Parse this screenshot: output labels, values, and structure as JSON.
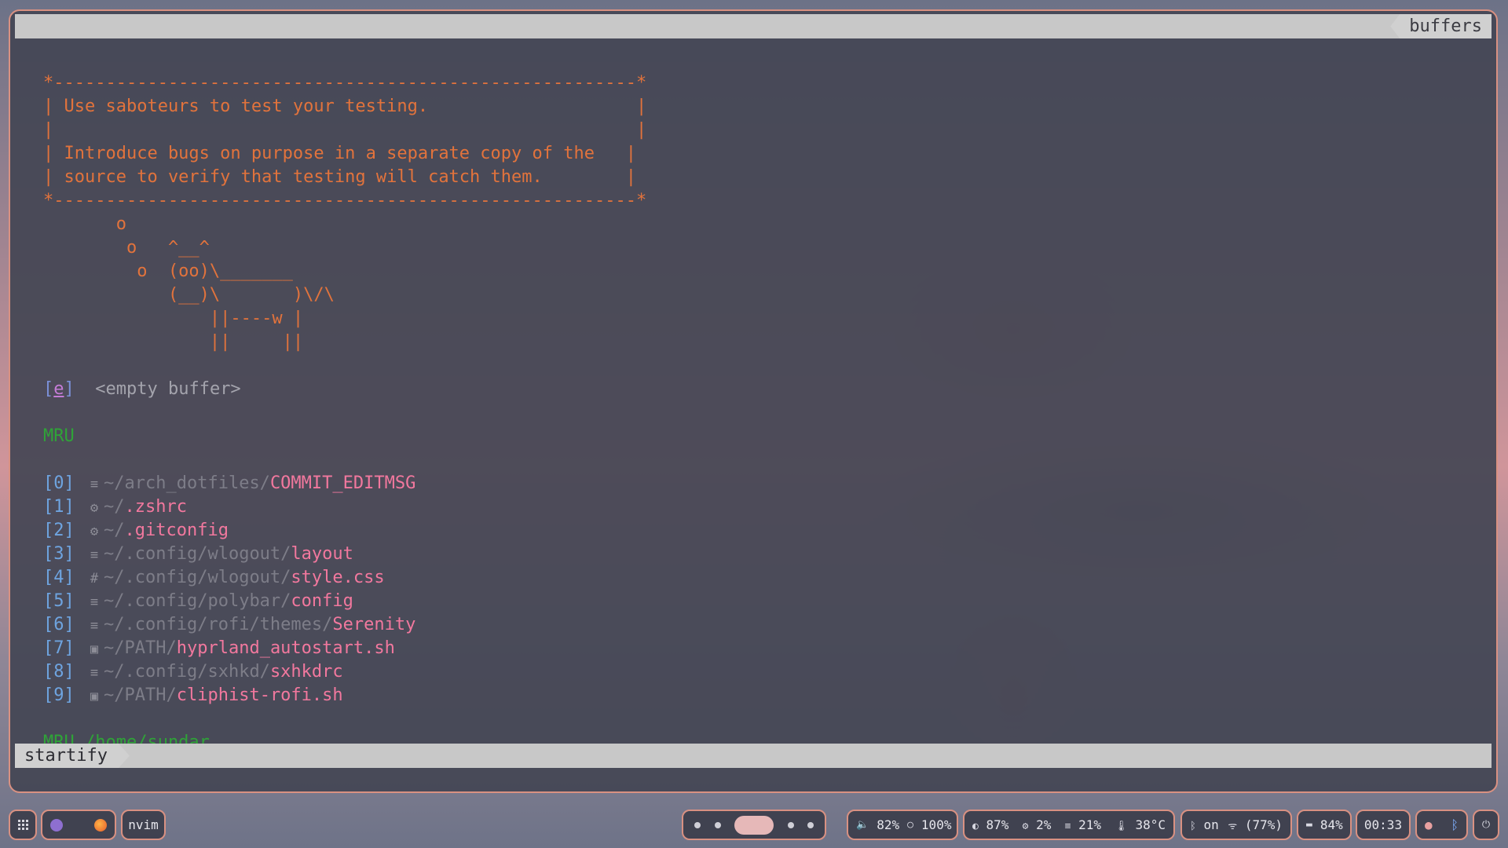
{
  "tabline": {
    "buffers_label": "buffers"
  },
  "banner": [
    "*--------------------------------------------------------*",
    "| Use saboteurs to test your testing.                    |",
    "|                                                        |",
    "| Introduce bugs on purpose in a separate copy of the   |",
    "| source to verify that testing will catch them.        |",
    "*--------------------------------------------------------*",
    "       o",
    "        o   ^__^",
    "         o  (oo)\\_______",
    "            (__)\\       )\\/\\",
    "                ||----w |",
    "                ||     ||"
  ],
  "empty_buffer": {
    "key": "e",
    "label": "<empty buffer>"
  },
  "mru": {
    "header": "MRU",
    "items": [
      {
        "index": "0",
        "icon": "≡",
        "icon_name": "text-file-icon",
        "prefix": "~/",
        "dir": "arch_dotfiles/",
        "file": "COMMIT_EDITMSG"
      },
      {
        "index": "1",
        "icon": "⚙",
        "icon_name": "gear-icon",
        "prefix": "~/",
        "dir": "",
        "file": ".zshrc"
      },
      {
        "index": "2",
        "icon": "⚙",
        "icon_name": "gear-icon",
        "prefix": "~/",
        "dir": "",
        "file": ".gitconfig"
      },
      {
        "index": "3",
        "icon": "≡",
        "icon_name": "text-file-icon",
        "prefix": "~/",
        "dir": ".config/wlogout/",
        "file": "layout"
      },
      {
        "index": "4",
        "icon": "#",
        "icon_name": "css-icon",
        "prefix": "~/",
        "dir": ".config/wlogout/",
        "file": "style.css"
      },
      {
        "index": "5",
        "icon": "≡",
        "icon_name": "text-file-icon",
        "prefix": "~/",
        "dir": ".config/polybar/",
        "file": "config"
      },
      {
        "index": "6",
        "icon": "≡",
        "icon_name": "text-file-icon",
        "prefix": "~/",
        "dir": ".config/rofi/themes/",
        "file": "Serenity"
      },
      {
        "index": "7",
        "icon": "▣",
        "icon_name": "terminal-icon",
        "prefix": "~/",
        "dir": "PATH/",
        "file": "hyprland_autostart.sh"
      },
      {
        "index": "8",
        "icon": "≡",
        "icon_name": "text-file-icon",
        "prefix": "~/",
        "dir": ".config/sxhkd/",
        "file": "sxhkdrc"
      },
      {
        "index": "9",
        "icon": "▣",
        "icon_name": "terminal-icon",
        "prefix": "~/",
        "dir": "PATH/",
        "file": "cliphist-rofi.sh"
      }
    ],
    "cwd_header": "MRU /home/sundar"
  },
  "statusline": {
    "mode": "startify"
  },
  "bar": {
    "window_title": "nvim",
    "volume": "82%",
    "brightness": "100%",
    "disk": "87%",
    "cpu": "2%",
    "memory": "21%",
    "temperature": "38°C",
    "bluetooth": "on",
    "wifi": "(77%)",
    "battery": "84%",
    "clock": "00:33"
  },
  "colors": {
    "accent_border": "#d99182",
    "banner": "#e2733c",
    "file": "#f2789e",
    "header_green": "#2fa338",
    "index_blue": "#6ea4e0"
  }
}
